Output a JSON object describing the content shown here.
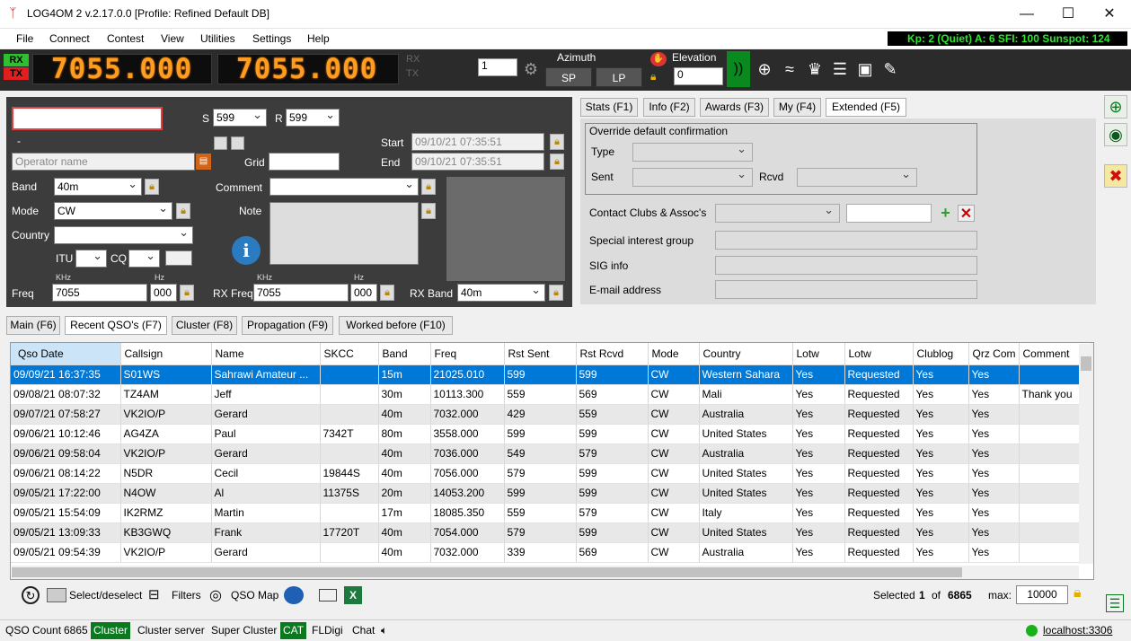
{
  "window": {
    "title": "LOG4OM 2 v.2.17.0.0 [Profile: Refined Default DB]"
  },
  "menu": [
    "File",
    "Connect",
    "Contest",
    "View",
    "Utilities",
    "Settings",
    "Help"
  ],
  "solar": "Kp: 2 (Quiet)  A: 6  SFI: 100 Sunspot: 124",
  "rig": {
    "rx_label": "RX",
    "tx_label": "TX",
    "freq_rx": "7055.000",
    "freq_tx": "7055.000",
    "dim_rx": "RX",
    "dim_tx": "TX",
    "vfo": "1",
    "azimuth_label": "Azimuth",
    "sp": "SP",
    "lp": "LP",
    "elevation_label": "Elevation",
    "elevation": "0"
  },
  "entry": {
    "callsign": "",
    "s_label": "S",
    "s_value": "599",
    "r_label": "R",
    "r_value": "599",
    "dash": "-",
    "start_label": "Start",
    "start_value": "09/10/21 07:35:51",
    "end_label": "End",
    "end_value": "09/10/21 07:35:51",
    "operator_placeholder": "Operator name",
    "grid_label": "Grid",
    "band_label": "Band",
    "band_value": "40m",
    "comment_label": "Comment",
    "mode_label": "Mode",
    "mode_value": "CW",
    "note_label": "Note",
    "country_label": "Country",
    "itu_label": "ITU",
    "cq_label": "CQ",
    "khz1": "KHz",
    "hz1": "Hz",
    "khz2": "KHz",
    "hz2": "Hz",
    "freq_label": "Freq",
    "freq_khz": "7055",
    "freq_hz": "000",
    "rxfreq_label": "RX Freq",
    "rxfreq_khz": "7055",
    "rxfreq_hz": "000",
    "rxband_label": "RX Band",
    "rxband_value": "40m"
  },
  "right_tabs": [
    "Stats (F1)",
    "Info (F2)",
    "Awards (F3)",
    "My (F4)",
    "Extended (F5)"
  ],
  "extended": {
    "override_title": "Override default confirmation",
    "type_label": "Type",
    "sent_label": "Sent",
    "rcvd_label": "Rcvd",
    "clubs_label": "Contact Clubs & Assoc's",
    "sig_group_label": "Special interest group",
    "sig_info_label": "SIG info",
    "email_label": "E-mail address"
  },
  "main_tabs": [
    "Main (F6)",
    "Recent QSO's (F7)",
    "Cluster (F8)",
    "Propagation (F9)",
    "Worked before (F10)"
  ],
  "grid": {
    "columns": [
      "Qso Date",
      "Callsign",
      "Name",
      "SKCC",
      "Band",
      "Freq",
      "Rst Sent",
      "Rst Rcvd",
      "Mode",
      "Country",
      "Lotw",
      "Lotw",
      "Clublog",
      "Qrz Com",
      "Comment"
    ],
    "rows": [
      [
        "09/09/21 16:37:35",
        "S01WS",
        "Sahrawi Amateur ...",
        "",
        "15m",
        "21025.010",
        "599",
        "599",
        "CW",
        "Western Sahara",
        "Yes",
        "Requested",
        "Yes",
        "Yes",
        ""
      ],
      [
        "09/08/21 08:07:32",
        "TZ4AM",
        "Jeff",
        "",
        "30m",
        "10113.300",
        "559",
        "569",
        "CW",
        "Mali",
        "Yes",
        "Requested",
        "Yes",
        "Yes",
        "Thank you"
      ],
      [
        "09/07/21 07:58:27",
        "VK2IO/P",
        "Gerard",
        "",
        "40m",
        "7032.000",
        "429",
        "559",
        "CW",
        "Australia",
        "Yes",
        "Requested",
        "Yes",
        "Yes",
        ""
      ],
      [
        "09/06/21 10:12:46",
        "AG4ZA",
        "Paul",
        "7342T",
        "80m",
        "3558.000",
        "599",
        "599",
        "CW",
        "United States",
        "Yes",
        "Requested",
        "Yes",
        "Yes",
        ""
      ],
      [
        "09/06/21 09:58:04",
        "VK2IO/P",
        "Gerard",
        "",
        "40m",
        "7036.000",
        "549",
        "579",
        "CW",
        "Australia",
        "Yes",
        "Requested",
        "Yes",
        "Yes",
        ""
      ],
      [
        "09/06/21 08:14:22",
        "N5DR",
        "Cecil",
        "19844S",
        "40m",
        "7056.000",
        "579",
        "599",
        "CW",
        "United States",
        "Yes",
        "Requested",
        "Yes",
        "Yes",
        ""
      ],
      [
        "09/05/21 17:22:00",
        "N4OW",
        "Al",
        "11375S",
        "20m",
        "14053.200",
        "599",
        "599",
        "CW",
        "United States",
        "Yes",
        "Requested",
        "Yes",
        "Yes",
        ""
      ],
      [
        "09/05/21 15:54:09",
        "IK2RMZ",
        "Martin",
        "",
        "17m",
        "18085.350",
        "559",
        "579",
        "CW",
        "Italy",
        "Yes",
        "Requested",
        "Yes",
        "Yes",
        ""
      ],
      [
        "09/05/21 13:09:33",
        "KB3GWQ",
        "Frank",
        "17720T",
        "40m",
        "7054.000",
        "579",
        "599",
        "CW",
        "United States",
        "Yes",
        "Requested",
        "Yes",
        "Yes",
        ""
      ],
      [
        "09/05/21 09:54:39",
        "VK2IO/P",
        "Gerard",
        "",
        "40m",
        "7032.000",
        "339",
        "569",
        "CW",
        "Australia",
        "Yes",
        "Requested",
        "Yes",
        "Yes",
        ""
      ]
    ]
  },
  "bottom": {
    "select_label": "Select/deselect",
    "filters_label": "Filters",
    "qsomap_label": "QSO Map",
    "selected_label": "Selected",
    "selected_count": "1",
    "of_label": "of",
    "total": "6865",
    "max_label": "max:",
    "max_value": "10000"
  },
  "status": {
    "qso_count_label": "QSO Count",
    "qso_count": "6865",
    "cluster": "Cluster",
    "cluster_server": "Cluster server",
    "super_cluster": "Super Cluster",
    "cat": "CAT",
    "fldigi": "FLDigi",
    "chat": "Chat",
    "server": "localhost:3306"
  }
}
